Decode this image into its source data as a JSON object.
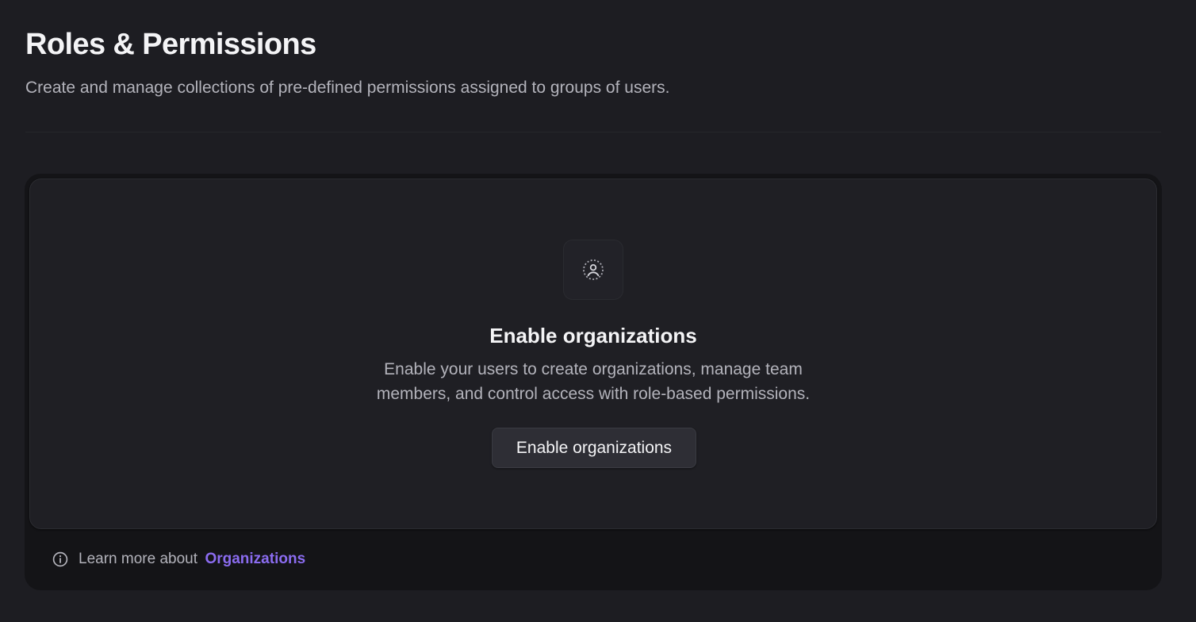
{
  "header": {
    "title": "Roles & Permissions",
    "subtitle": "Create and manage collections of pre-defined permissions assigned to groups of users."
  },
  "empty_state": {
    "icon": "user-circle-dashed-icon",
    "title": "Enable organizations",
    "description": "Enable your users to create organizations, manage team members, and control access with role-based permissions.",
    "button_label": "Enable organizations"
  },
  "footer": {
    "icon": "info-icon",
    "text": "Learn more about",
    "link_label": "Organizations"
  },
  "colors": {
    "background": "#1d1d22",
    "card": "#1f1f24",
    "card_footer": "#141417",
    "link": "#8b6cf0"
  }
}
